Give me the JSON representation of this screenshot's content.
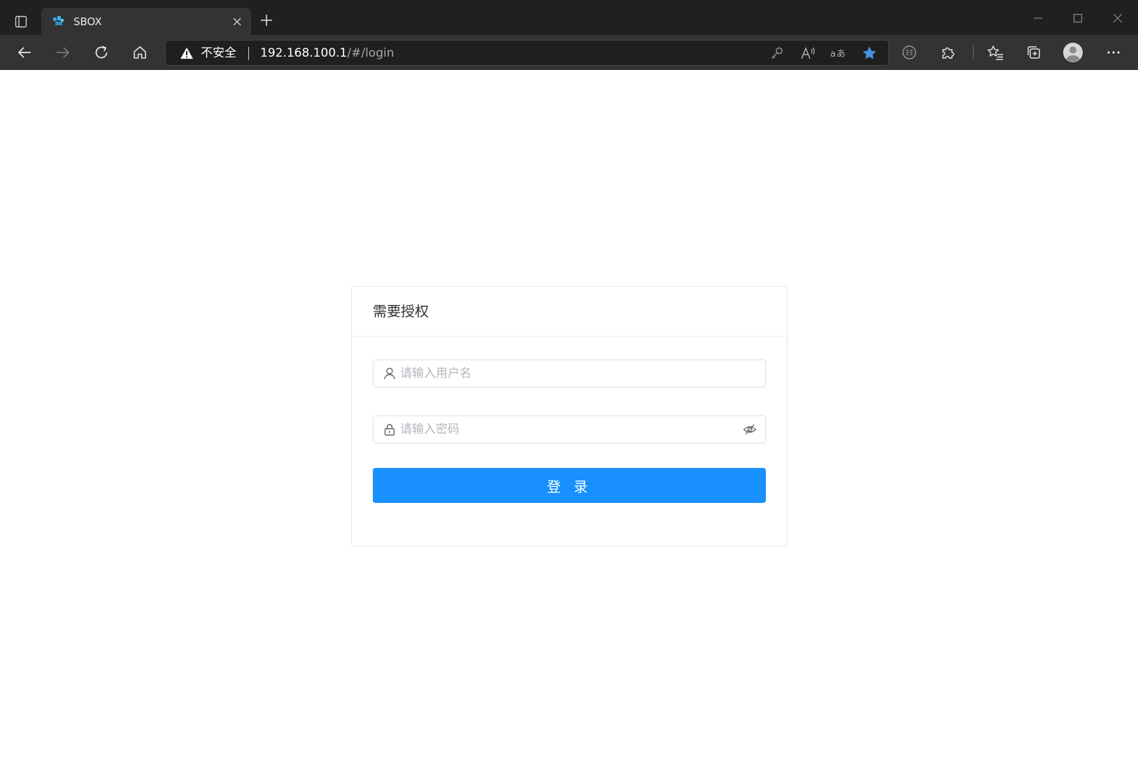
{
  "browser": {
    "tab": {
      "title": "SBOX"
    },
    "address_bar": {
      "security_label": "不安全",
      "url_host": "192.168.100.1",
      "url_path": "/#/login"
    },
    "accent_color": "#4a90e2"
  },
  "login": {
    "title": "需要授权",
    "username": {
      "placeholder": "请输入用户名",
      "value": "",
      "icon": "user-icon"
    },
    "password": {
      "placeholder": "请输入密码",
      "value": "",
      "icon": "lock-icon",
      "toggle_icon": "eye-off-icon"
    },
    "submit_label": "登 录",
    "button_color": "#1890ff"
  }
}
